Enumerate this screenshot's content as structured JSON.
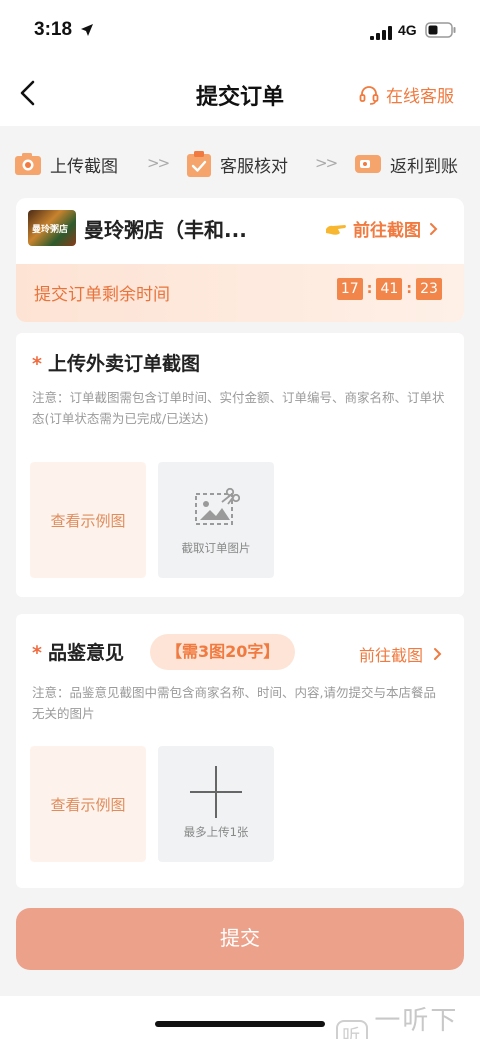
{
  "status_bar": {
    "time": "3:18",
    "network": "4G"
  },
  "nav": {
    "title": "提交订单",
    "customer_service": "在线客服"
  },
  "steps": [
    {
      "label": "上传截图",
      "icon": "camera-icon"
    },
    {
      "label": "客服核对",
      "icon": "clipboard-check-icon"
    },
    {
      "label": "返利到账",
      "icon": "wallet-icon"
    }
  ],
  "step_separator": ">>",
  "shop": {
    "logo_text": "曼玲粥店",
    "name": "曼玲粥店（丰和...",
    "goto_label": "前往截图",
    "timer_label": "提交订单剩余时间",
    "timer": {
      "hours": "17",
      "minutes": "41",
      "seconds": "23"
    }
  },
  "order_section": {
    "title": "上传外卖订单截图",
    "note": "注意：订单截图需包含订单时间、实付金额、订单编号、商家名称、订单状态(订单状态需为已完成/已送达)",
    "example_label": "查看示例图",
    "upload_label": "截取订单图片"
  },
  "review_section": {
    "title": "品鉴意见",
    "requirement": "【需3图20字】",
    "goto_label": "前往截图",
    "note": "注意：品鉴意见截图中需包含商家名称、时间、内容,请勿提交与本店餐品无关的图片",
    "example_label": "查看示例图",
    "upload_label": "最多上传1张"
  },
  "submit_label": "提交",
  "watermark": "一听下载",
  "colors": {
    "accent": "#f07a3f",
    "submit_bg": "#eca28a",
    "example_bg": "#fdf3ec",
    "upload_bg": "#f0f2f3"
  }
}
